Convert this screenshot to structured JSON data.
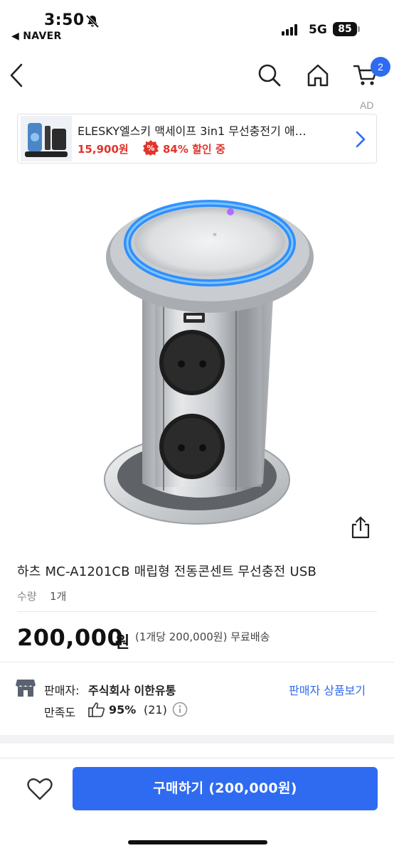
{
  "status_bar": {
    "time": "3:50",
    "back_app": "◀ NAVER",
    "network": "5G",
    "battery": "85"
  },
  "nav": {
    "cart_count": "2"
  },
  "ad": {
    "label": "AD",
    "title": "ELESKY엘스키 맥세이프 3in1 무선충전기 애…",
    "price": "15,900원",
    "discount": "84% 할인 중"
  },
  "product": {
    "title": "하츠 MC-A1201CB 매립형 전동콘센트 무선충전 USB",
    "qty_label": "수량",
    "qty_value": "1개",
    "price": "200,000",
    "price_unit": "원",
    "price_detail": "(1개당 200,000원) 무료배송"
  },
  "seller": {
    "label": "판매자:",
    "name": "주식회사 이한유통",
    "link": "판매자 상품보기",
    "satisfaction_label": "만족도",
    "satisfaction_value": "95%",
    "satisfaction_count": "(21)"
  },
  "bottom_bar": {
    "buy_label": "구매하기 (200,000원)"
  },
  "colors": {
    "accent": "#2f6bf0",
    "sale": "#e0352b"
  },
  "icons": [
    "bell-slash-icon",
    "signal-icon",
    "battery-icon",
    "back-arrow-icon",
    "search-icon",
    "home-icon",
    "cart-icon",
    "chevron-right-icon",
    "discount-icon",
    "share-icon",
    "store-icon",
    "thumbs-up-icon",
    "info-icon",
    "heart-icon"
  ]
}
